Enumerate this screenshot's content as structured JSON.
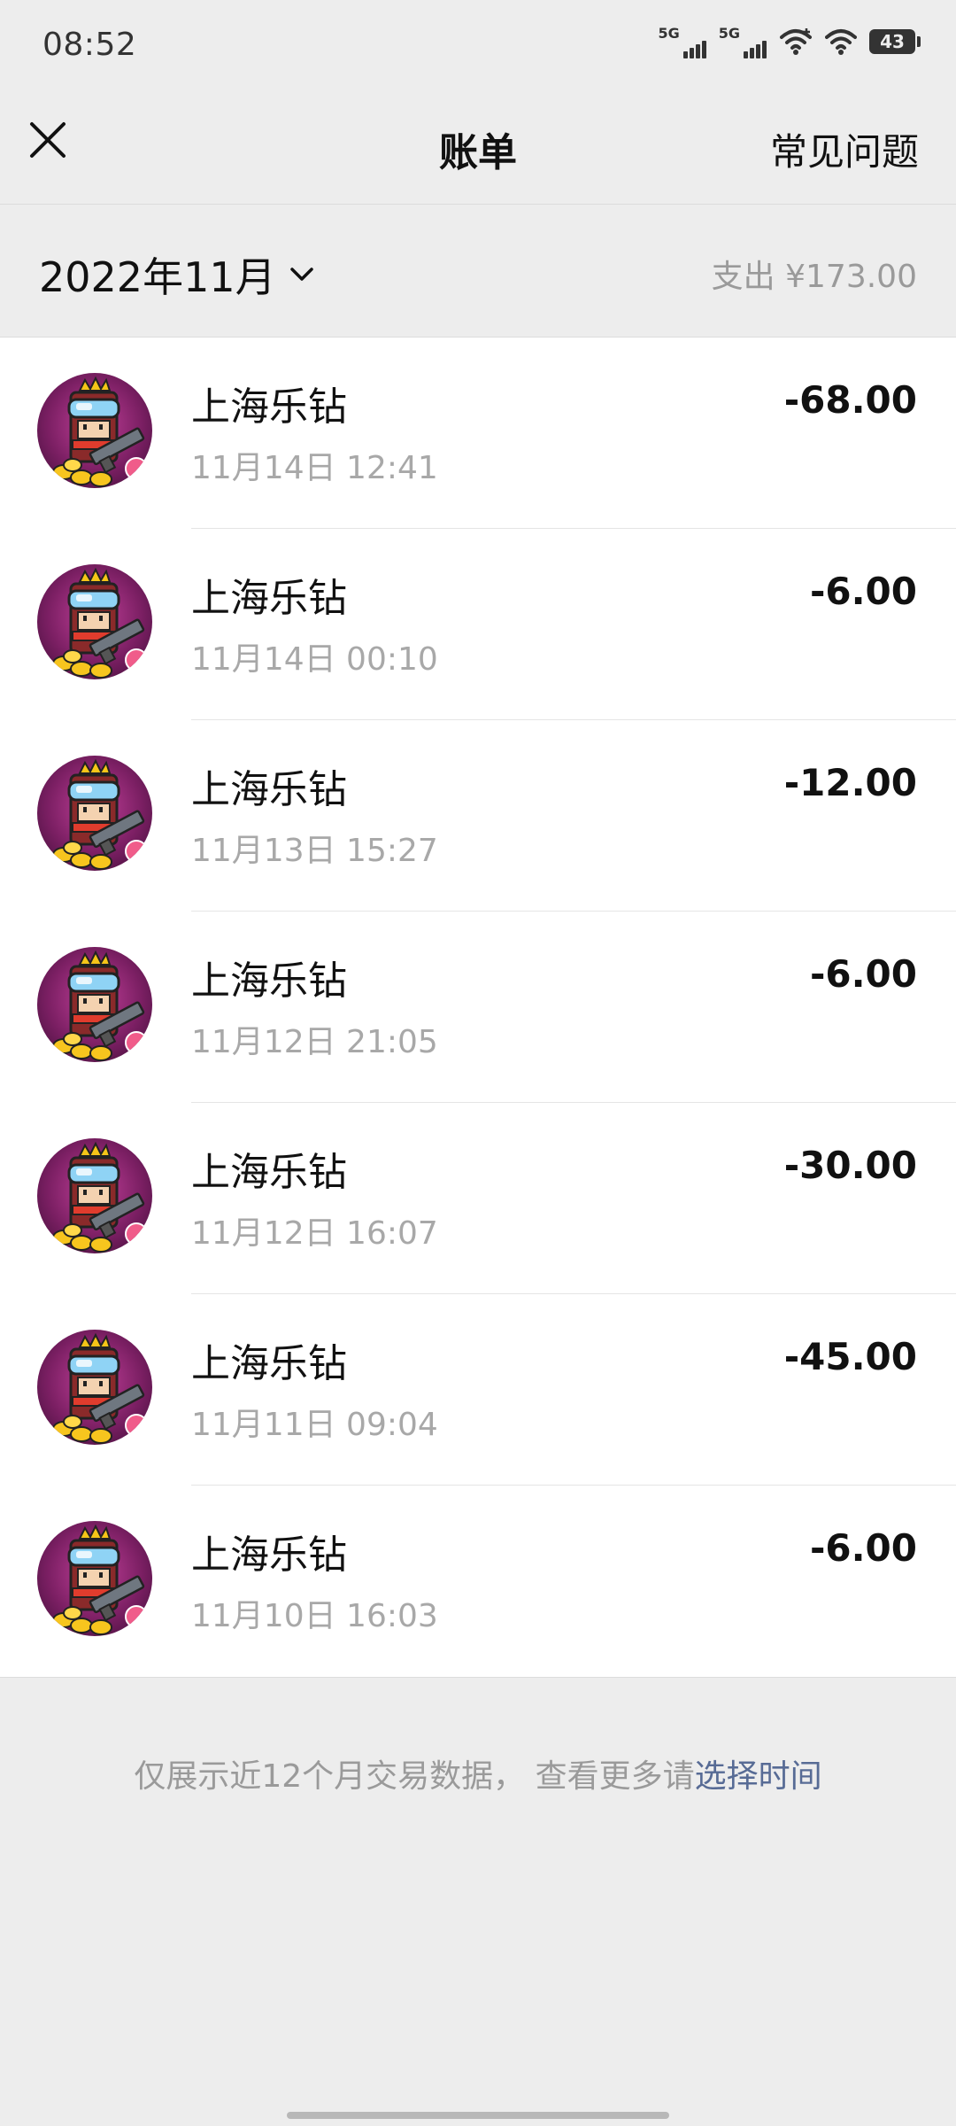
{
  "status_bar": {
    "time": "08:52",
    "signal_1_label": "5G",
    "signal_2_label": "5G",
    "battery_level": "43"
  },
  "header": {
    "close_icon": "close-icon",
    "title": "账单",
    "faq": "常见问题"
  },
  "month_bar": {
    "month": "2022年11月",
    "spend_summary": "支出 ¥173.00"
  },
  "transactions": [
    {
      "name": "上海乐钻",
      "time": "11月14日 12:41",
      "amount": "-68.00"
    },
    {
      "name": "上海乐钻",
      "time": "11月14日 00:10",
      "amount": "-6.00"
    },
    {
      "name": "上海乐钻",
      "time": "11月13日 15:27",
      "amount": "-12.00"
    },
    {
      "name": "上海乐钻",
      "time": "11月12日 21:05",
      "amount": "-6.00"
    },
    {
      "name": "上海乐钻",
      "time": "11月12日 16:07",
      "amount": "-30.00"
    },
    {
      "name": "上海乐钻",
      "time": "11月11日 09:04",
      "amount": "-45.00"
    },
    {
      "name": "上海乐钻",
      "time": "11月10日 16:03",
      "amount": "-6.00"
    }
  ],
  "footer": {
    "note": "仅展示近12个月交易数据， 查看更多请",
    "link": "选择时间"
  },
  "colors": {
    "background": "#ededed",
    "list_background": "#ffffff",
    "link": "#576b95",
    "secondary_text": "#a8a8a8"
  }
}
